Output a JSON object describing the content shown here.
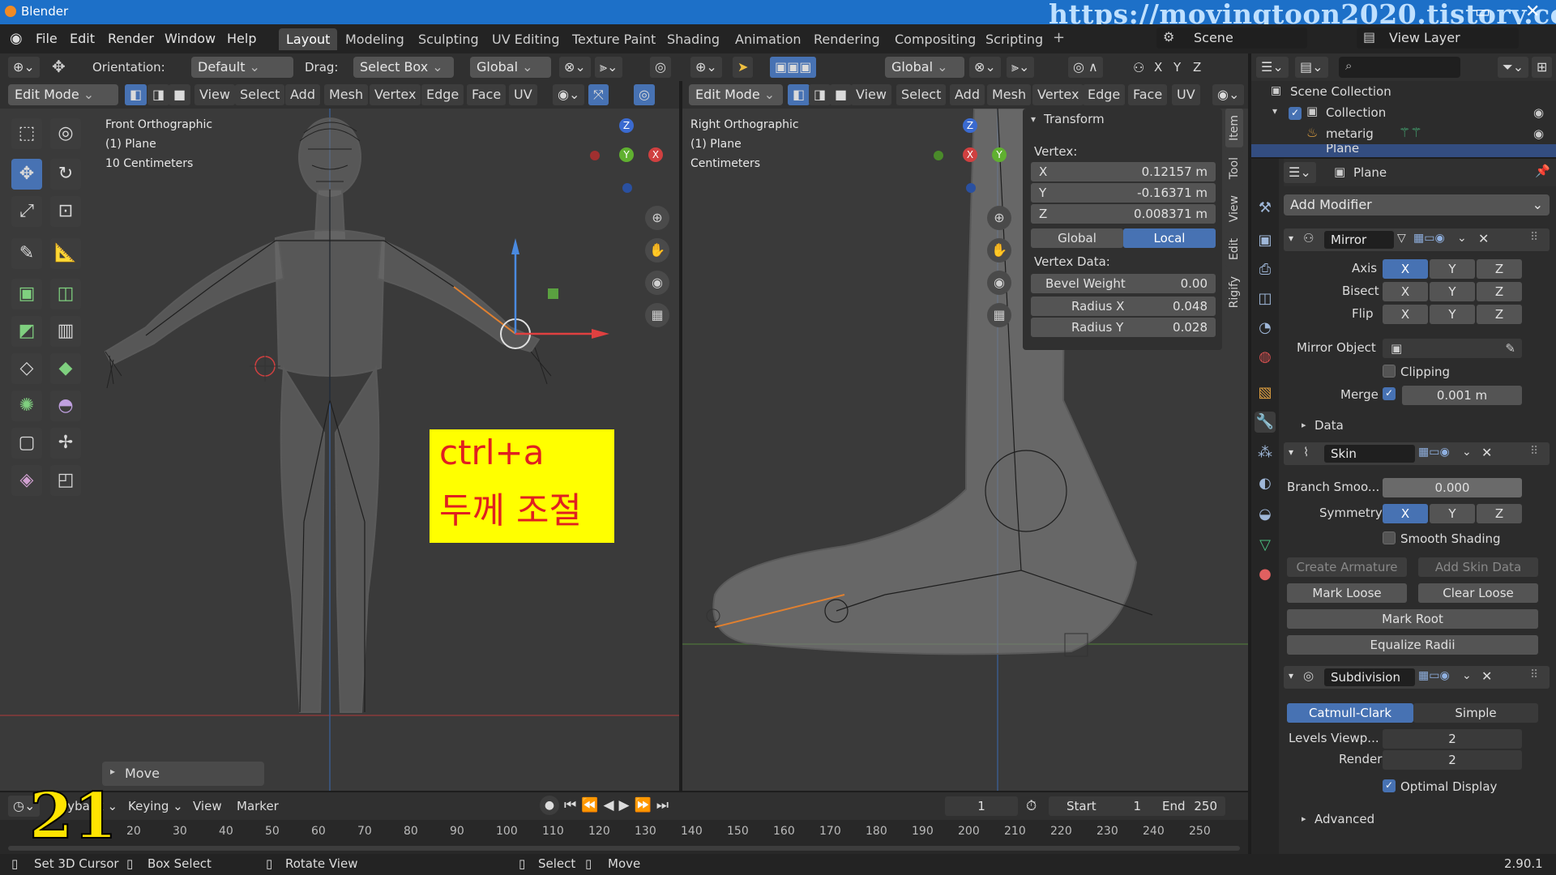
{
  "titlebar": {
    "app": "Blender",
    "watermark": "https://movingtoon2020.tistory.com",
    "minimize": "▭",
    "close": "✕"
  },
  "menu": {
    "items": [
      "File",
      "Edit",
      "Render",
      "Window",
      "Help"
    ]
  },
  "workspaces": [
    "Layout",
    "Modeling",
    "Sculpting",
    "UV Editing",
    "Texture Paint",
    "Shading",
    "Animation",
    "Rendering",
    "Compositing",
    "Scripting"
  ],
  "scene": {
    "label": "Scene",
    "view_layer": "View Layer"
  },
  "toolheader": {
    "orientation_label": "Orientation:",
    "orientation_value": "Default",
    "drag_label": "Drag:",
    "drag_value": "Select Box",
    "transform_orientation": "Global"
  },
  "left_header": {
    "mode": "Edit Mode",
    "menus": [
      "View",
      "Select",
      "Add",
      "Mesh",
      "Vertex",
      "Edge",
      "Face",
      "UV"
    ]
  },
  "right_header": {
    "mode": "Edit Mode",
    "orientation": "Global",
    "menus": [
      "View",
      "Select",
      "Add",
      "Mesh",
      "Vertex",
      "Edge",
      "Face",
      "UV"
    ],
    "axes": [
      "X",
      "Y",
      "Z"
    ]
  },
  "left_viewport": {
    "view_name": "Front Orthographic",
    "object": "(1) Plane",
    "scale": "10 Centimeters",
    "annotation_line1": "ctrl+a",
    "annotation_line2": "두께 조절",
    "gizmo": {
      "z": "Z",
      "y": "Y",
      "x": "X"
    },
    "operator_panel": "Move"
  },
  "right_viewport": {
    "view_name": "Right Orthographic",
    "object": "(1) Plane",
    "scale": "Centimeters",
    "gizmo": {
      "z": "Z",
      "y": "Y",
      "x": "X"
    }
  },
  "transform_panel": {
    "title": "Transform",
    "vertex_label": "Vertex:",
    "x_label": "X",
    "x_value": "0.12157 m",
    "y_label": "Y",
    "y_value": "-0.16371 m",
    "z_label": "Z",
    "z_value": "0.008371 m",
    "global": "Global",
    "local": "Local",
    "vertex_data_label": "Vertex Data:",
    "bevel_label": "Bevel Weight",
    "bevel_value": "0.00",
    "radius_x_label": "Radius X",
    "radius_x_value": "0.048",
    "radius_y_label": "Radius Y",
    "radius_y_value": "0.028"
  },
  "side_tabs": [
    "Item",
    "Tool",
    "View",
    "Edit",
    "Rigify"
  ],
  "outliner": {
    "scene_collection": "Scene Collection",
    "collection": "Collection",
    "metarig": "metarig",
    "plane": "Plane"
  },
  "properties": {
    "object_name": "Plane",
    "add_modifier": "Add Modifier",
    "mirror": {
      "name": "Mirror",
      "axis_label": "Axis",
      "bisect_label": "Bisect",
      "flip_label": "Flip",
      "x": "X",
      "y": "Y",
      "z": "Z",
      "mirror_object_label": "Mirror Object",
      "clipping_label": "Clipping",
      "merge_label": "Merge",
      "merge_value": "0.001 m",
      "data_label": "Data"
    },
    "skin": {
      "name": "Skin",
      "branch_label": "Branch Smoo...",
      "branch_value": "0.000",
      "symmetry_label": "Symmetry",
      "x": "X",
      "y": "Y",
      "z": "Z",
      "smooth_label": "Smooth Shading",
      "create_armature": "Create Armature",
      "add_skin_data": "Add Skin Data",
      "mark_loose": "Mark Loose",
      "clear_loose": "Clear Loose",
      "mark_root": "Mark Root",
      "equalize": "Equalize Radii"
    },
    "subdivision": {
      "name": "Subdivision",
      "catmull": "Catmull-Clark",
      "simple": "Simple",
      "levels_label": "Levels Viewp...",
      "levels_value": "2",
      "render_label": "Render",
      "render_value": "2",
      "optimal_label": "Optimal Display",
      "advanced_label": "Advanced"
    }
  },
  "timeline": {
    "overlay_number": "21",
    "playback": "ayback",
    "keying": "Keying",
    "view": "View",
    "marker": "Marker",
    "current_frame": "1",
    "start_label": "Start",
    "start_value": "1",
    "end_label": "End",
    "end_value": "250",
    "ticks": [
      "20",
      "30",
      "40",
      "50",
      "60",
      "70",
      "80",
      "90",
      "100",
      "110",
      "120",
      "130",
      "140",
      "150",
      "160",
      "170",
      "180",
      "190",
      "200",
      "210",
      "220",
      "230",
      "240",
      "250"
    ]
  },
  "statusbar": {
    "set_cursor": "Set 3D Cursor",
    "box_select": "Box Select",
    "rotate_view": "Rotate View",
    "select": "Select",
    "move": "Move",
    "version": "2.90.1"
  }
}
